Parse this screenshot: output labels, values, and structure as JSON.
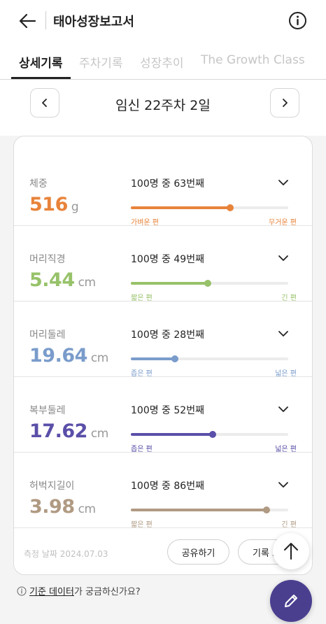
{
  "header": {
    "title": "태아성장보고서",
    "back_icon": "arrow-left-icon",
    "info_icon": "info-icon"
  },
  "tabs": [
    {
      "label": "상세기록",
      "active": true
    },
    {
      "label": "주차기록",
      "active": false
    },
    {
      "label": "성장추이",
      "active": false
    },
    {
      "label": "The Growth Class",
      "active": false
    }
  ],
  "week_nav": {
    "label": "임신 22주차 2일",
    "prev_icon": "chevron-left-icon",
    "next_icon": "chevron-right-icon"
  },
  "metrics": [
    {
      "name": "체중",
      "value": "516",
      "unit": "g",
      "rank": "100명 중 63번째",
      "percent": 63,
      "color": "#e8833a",
      "left_label": "가벼운 편",
      "right_label": "무거운 편"
    },
    {
      "name": "머리직경",
      "value": "5.44",
      "unit": "cm",
      "rank": "100명 중 49번째",
      "percent": 49,
      "color": "#97c26a",
      "left_label": "짧은 편",
      "right_label": "긴 편"
    },
    {
      "name": "머리둘레",
      "value": "19.64",
      "unit": "cm",
      "rank": "100명 중 28번째",
      "percent": 28,
      "color": "#7a9ccb",
      "left_label": "좁은 편",
      "right_label": "넓은 편"
    },
    {
      "name": "복부둘레",
      "value": "17.62",
      "unit": "cm",
      "rank": "100명 중 52번째",
      "percent": 52,
      "color": "#5a4fa8",
      "left_label": "좁은 편",
      "right_label": "넓은 편"
    },
    {
      "name": "허벅지길이",
      "value": "3.98",
      "unit": "cm",
      "rank": "100명 중 86번째",
      "percent": 86,
      "color": "#b09a82",
      "left_label": "짧은 편",
      "right_label": "긴 편"
    }
  ],
  "footer": {
    "measure_date": "측정 날짜 2024.07.03",
    "share_label": "공유하기",
    "record_label": "기록 보"
  },
  "help": {
    "link": "기준 데이터",
    "rest": "가 궁금하신가요?"
  },
  "colors": {
    "fab": "#4a3f8f"
  }
}
